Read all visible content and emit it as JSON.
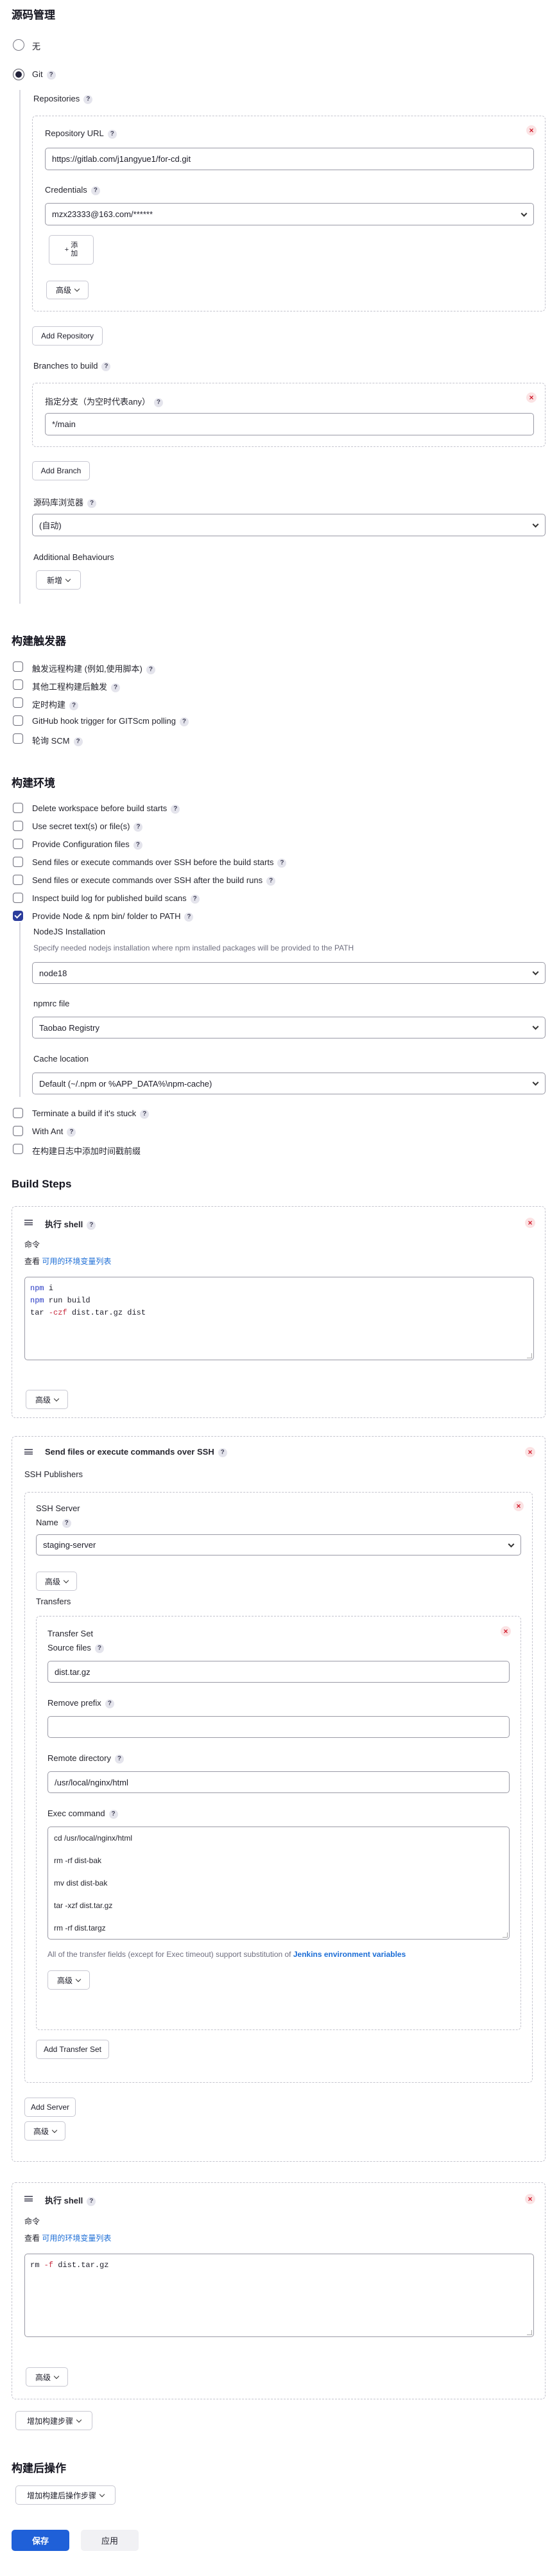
{
  "scm": {
    "title": "源码管理",
    "none_label": "无",
    "git_label": "Git",
    "repositories_label": "Repositories",
    "repo_url_label": "Repository URL",
    "repo_url_value": "https://gitlab.com/j1angyue1/for-cd.git",
    "credentials_label": "Credentials",
    "credentials_value": "mzx23333@163.com/******",
    "add_credentials_label": "添\n加",
    "advanced_label": "高级",
    "add_repository_label": "Add Repository",
    "branches_label": "Branches to build",
    "branch_specifier_label": "指定分支（为空时代表any）",
    "branch_value": "*/main",
    "add_branch_label": "Add Branch",
    "browser_label": "源码库浏览器",
    "browser_value": "(自动)",
    "additional_behaviours_label": "Additional Behaviours",
    "add_behaviour_label": "新增"
  },
  "triggers": {
    "title": "构建触发器",
    "items": [
      {
        "label": "触发远程构建 (例如,使用脚本)",
        "checked": false
      },
      {
        "label": "其他工程构建后触发",
        "checked": false
      },
      {
        "label": "定时构建",
        "checked": false
      },
      {
        "label": "GitHub hook trigger for GITScm polling",
        "checked": false
      },
      {
        "label": "轮询 SCM",
        "checked": false
      }
    ]
  },
  "env": {
    "title": "构建环境",
    "items": [
      {
        "label": "Delete workspace before build starts",
        "checked": false
      },
      {
        "label": "Use secret text(s) or file(s)",
        "checked": false
      },
      {
        "label": "Provide Configuration files",
        "checked": false
      },
      {
        "label": "Send files or execute commands over SSH before the build starts",
        "checked": false
      },
      {
        "label": "Send files or execute commands over SSH after the build runs",
        "checked": false
      },
      {
        "label": "Inspect build log for published build scans",
        "checked": false
      },
      {
        "label": "Provide Node & npm bin/ folder to PATH",
        "checked": true
      }
    ],
    "nodejs_label": "NodeJS Installation",
    "nodejs_desc": "Specify needed nodejs installation where npm installed packages will be provided to the PATH",
    "nodejs_value": "node18",
    "npmrc_label": "npmrc file",
    "npmrc_value": "Taobao Registry",
    "cache_label": "Cache location",
    "cache_value": "Default (~/.npm or %APP_DATA%\\npm-cache)",
    "after_items": [
      {
        "label": "Terminate a build if it's stuck",
        "checked": false
      },
      {
        "label": "With Ant",
        "checked": false
      },
      {
        "label": "在构建日志中添加时间戳前缀",
        "checked": false
      }
    ]
  },
  "build_steps": {
    "title": "Build Steps",
    "shell1": {
      "title": "执行 shell",
      "command_label": "命令",
      "see_prefix": "查看",
      "see_link": "可用的环境变量列表",
      "lines": [
        [
          {
            "t": "npm",
            "c": "kw"
          },
          {
            "t": " i",
            "c": "plain"
          }
        ],
        [
          {
            "t": "npm",
            "c": "kw"
          },
          {
            "t": " run build",
            "c": "plain"
          }
        ],
        [
          {
            "t": "tar ",
            "c": "plain"
          },
          {
            "t": "-czf",
            "c": "op"
          },
          {
            "t": " dist.tar.gz dist",
            "c": "plain"
          }
        ]
      ],
      "advanced_label": "高级"
    },
    "ssh": {
      "title": "Send files or execute commands over SSH",
      "publishers_label": "SSH Publishers",
      "server_label": "SSH Server",
      "name_label": "Name",
      "name_value": "staging-server",
      "advanced_label": "高级",
      "transfers_label": "Transfers",
      "transfer_set_label": "Transfer Set",
      "source_files_label": "Source files",
      "source_files_value": "dist.tar.gz",
      "remove_prefix_label": "Remove prefix",
      "remove_prefix_value": "",
      "remote_dir_label": "Remote directory",
      "remote_dir_value": "/usr/local/nginx/html",
      "exec_label": "Exec command",
      "exec_lines": [
        "cd /usr/local/nginx/html",
        "rm -rf dist-bak",
        "mv dist dist-bak",
        "tar -xzf dist.tar.gz",
        "rm -rf dist.targz"
      ],
      "note_prefix": "All of the transfer fields (except for Exec timeout) support substitution of ",
      "note_link": "Jenkins environment variables",
      "transfer_advanced_label": "高级",
      "add_transfer_label": "Add Transfer Set",
      "add_server_label": "Add Server",
      "outer_advanced_label": "高级"
    },
    "shell2": {
      "title": "执行 shell",
      "command_label": "命令",
      "see_prefix": "查看",
      "see_link": "可用的环境变量列表",
      "lines": [
        [
          {
            "t": "rm ",
            "c": "plain"
          },
          {
            "t": "-f",
            "c": "op"
          },
          {
            "t": " dist.tar.gz",
            "c": "plain"
          }
        ]
      ],
      "advanced_label": "高级"
    },
    "add_step_label": "增加构建步骤"
  },
  "post": {
    "title": "构建后操作",
    "add_label": "增加构建后操作步骤"
  },
  "footer": {
    "save_label": "保存",
    "apply_label": "应用"
  },
  "colors": {
    "primary": "#1f60d8",
    "link": "#1d6ed6",
    "checkbox_checked": "#2c3d9c",
    "delete_red": "#d11a2a"
  }
}
